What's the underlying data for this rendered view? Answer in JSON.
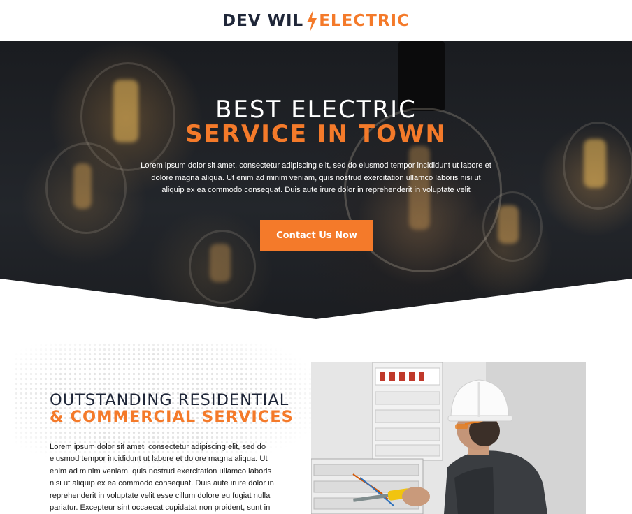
{
  "header": {
    "logo_left": "DEV WIL",
    "logo_right": "ELECTRIC",
    "logo_icon": "lightning-bolt-icon"
  },
  "hero": {
    "title_line1": "BEST ELECTRIC",
    "title_line2": "SERVICE IN TOWN",
    "body": "Lorem ipsum dolor sit amet, consectetur adipiscing elit, sed do eiusmod tempor incididunt ut labore et dolore magna aliqua. Ut enim ad minim veniam, quis nostrud exercitation ullamco laboris nisi ut aliquip ex ea commodo consequat. Duis aute irure dolor in reprehenderit in voluptate velit",
    "cta_label": "Contact Us Now"
  },
  "services": {
    "title_line1": "OUTSTANDING RESIDENTIAL",
    "title_line2": "& COMMERCIAL SERVICES",
    "body": "Lorem ipsum dolor sit amet, consectetur adipiscing elit, sed do eiusmod tempor incididunt ut labore et dolore magna aliqua. Ut enim ad minim veniam, quis nostrud exercitation ullamco laboris nisi ut aliquip ex ea commodo consequat. Duis aute irure dolor in reprehenderit in voluptate velit esse cillum dolore eu fugiat nulla pariatur. Excepteur sint occaecat cupidatat non proident, sunt in"
  },
  "colors": {
    "accent": "#f47a2a",
    "navy": "#1f2638",
    "hero_dark": "#1c1e22"
  }
}
